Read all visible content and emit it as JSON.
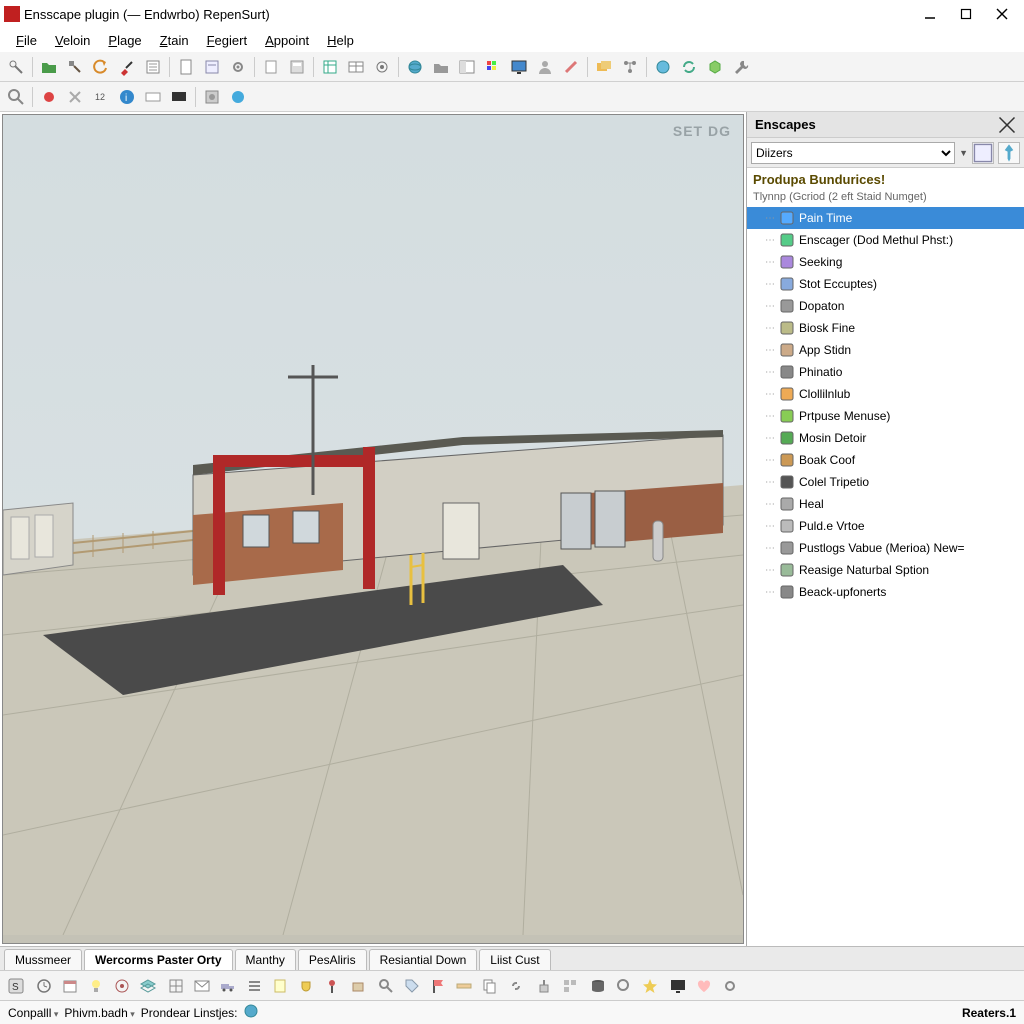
{
  "window": {
    "title": "Ensscape plugin (— Endwrbo) RepenSurt)"
  },
  "menu": [
    "File",
    "Veloin",
    "Plage",
    "Ztain",
    "Fegiert",
    "Appoint",
    "Help"
  ],
  "watermark": "SET DG",
  "panel": {
    "title": "Enscapes",
    "dropdown": "Diizers",
    "heading": "Produpa Bundurices!",
    "subheading": "Tlynnp (Gcriod (2 eft Staid Numget)",
    "items": [
      {
        "label": "Pain Time",
        "selected": true
      },
      {
        "label": "Enscager (Dod Methul Phst:)"
      },
      {
        "label": "Seeking"
      },
      {
        "label": "Stot Eccuptes)"
      },
      {
        "label": "Dopaton"
      },
      {
        "label": "Biosk Fine"
      },
      {
        "label": "App Stidn"
      },
      {
        "label": "Phinatio"
      },
      {
        "label": "Clollilnlub"
      },
      {
        "label": "Prtpuse Menuse)"
      },
      {
        "label": "Mosin Detoir"
      },
      {
        "label": "Boak Coof"
      },
      {
        "label": "Colel Tripetio"
      },
      {
        "label": "Heal"
      },
      {
        "label": "Puld.e Vrtoe"
      },
      {
        "label": "Pustlogs Vabue (Merioa) New="
      },
      {
        "label": "Reasige Naturbal Sption"
      },
      {
        "label": "Beack-upfonerts"
      }
    ]
  },
  "tabs": [
    "Mussmeer",
    "Wercorms Paster Orty",
    "Manthy",
    "PesAliris",
    "Resiantial Down",
    "Liist Cust"
  ],
  "status": {
    "left1": "Conpalll",
    "left2": "Phivm.badh",
    "left3": "Prondear Linstjes:",
    "right": "Reaters.1"
  }
}
